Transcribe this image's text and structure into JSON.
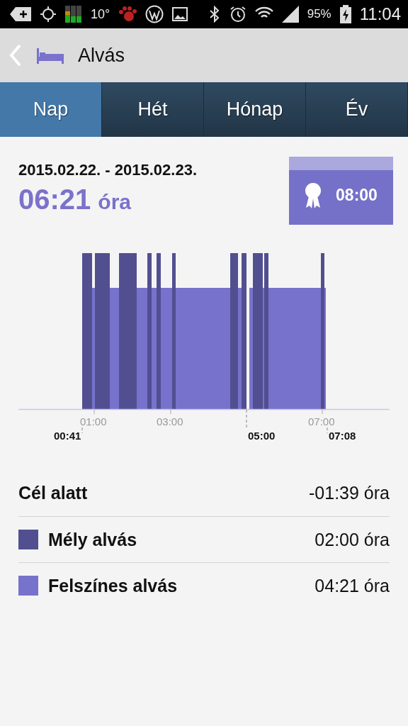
{
  "status_bar": {
    "temperature": "10°",
    "battery": "95%",
    "time": "11:04"
  },
  "header": {
    "title": "Alvás"
  },
  "tabs": [
    {
      "label": "Nap",
      "selected": true
    },
    {
      "label": "Hét",
      "selected": false
    },
    {
      "label": "Hónap",
      "selected": false
    },
    {
      "label": "Év",
      "selected": false
    }
  ],
  "summary": {
    "date_range": "2015.02.22. - 2015.02.23.",
    "total": "06:21",
    "unit": "óra"
  },
  "goal": {
    "value": "08:00"
  },
  "chart": {
    "axis_labels": [
      "01:00",
      "03:00",
      "07:00"
    ],
    "markers": [
      "00:41",
      "05:00",
      "07:08"
    ]
  },
  "rows": [
    {
      "kind": "total",
      "label": "Cél alatt",
      "value": "-01:39 óra"
    },
    {
      "kind": "legend",
      "label": "Mély alvás",
      "value": "02:00 óra",
      "color": "#524f91"
    },
    {
      "kind": "legend",
      "label": "Felszínes alvás",
      "value": "04:21 óra",
      "color": "#7772cb"
    }
  ]
}
